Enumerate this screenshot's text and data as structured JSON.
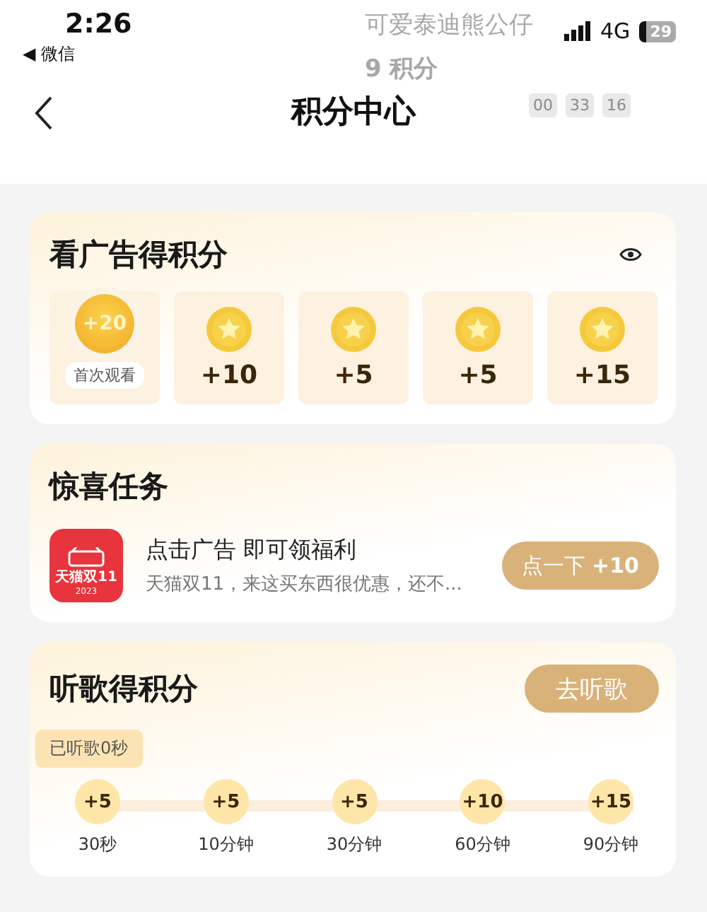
{
  "status_bar": {
    "time": "2:26",
    "back_app": "◀ 微信",
    "network": "4G",
    "battery": "29"
  },
  "background_product": {
    "name": "可爱泰迪熊公仔",
    "points": "9 积分",
    "timer": [
      "00",
      "33",
      "16"
    ]
  },
  "nav": {
    "title": "积分中心"
  },
  "ad_card": {
    "title": "看广告得积分",
    "rewards": [
      {
        "kind": "first",
        "points": "+20",
        "caption": "首次观看"
      },
      {
        "kind": "coin",
        "points": "+10"
      },
      {
        "kind": "coin",
        "points": "+5"
      },
      {
        "kind": "coin",
        "points": "+5"
      },
      {
        "kind": "coin",
        "points": "+15"
      }
    ]
  },
  "task_card": {
    "title": "惊喜任务",
    "logo_label": "天猫双11",
    "logo_year": "2023",
    "heading": "点击广告 即可领福利",
    "description": "天猫双11，来这买东西很优惠，还不...",
    "button": {
      "label": "点一下",
      "points": "+10"
    }
  },
  "music_card": {
    "title": "听歌得积分",
    "button": "去听歌",
    "progress_label": "已听歌0秒",
    "milestones": [
      {
        "points": "+5",
        "time": "30秒"
      },
      {
        "points": "+5",
        "time": "10分钟"
      },
      {
        "points": "+5",
        "time": "30分钟"
      },
      {
        "points": "+10",
        "time": "60分钟"
      },
      {
        "points": "+15",
        "time": "90分钟"
      }
    ]
  }
}
